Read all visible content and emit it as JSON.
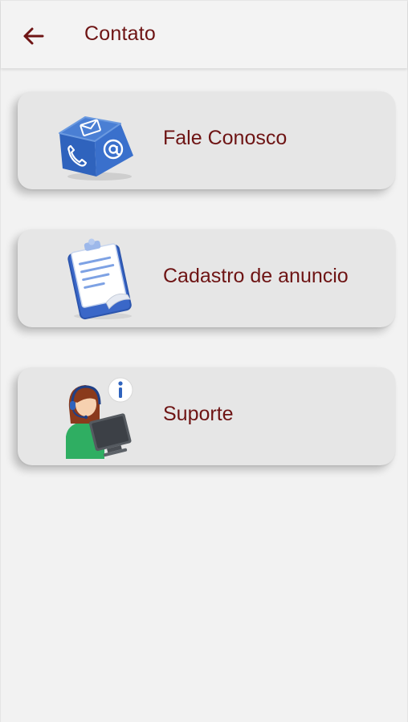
{
  "header": {
    "title": "Contato",
    "back_icon": "arrow-left-icon"
  },
  "menu": {
    "items": [
      {
        "label": "Fale Conosco",
        "icon": "contact-cube-icon"
      },
      {
        "label": "Cadastro de anuncio",
        "icon": "clipboard-document-icon"
      },
      {
        "label": "Suporte",
        "icon": "support-agent-icon"
      }
    ]
  },
  "colors": {
    "accent": "#6e1414",
    "background": "#f2f2f2",
    "card": "#e6e6e6"
  }
}
